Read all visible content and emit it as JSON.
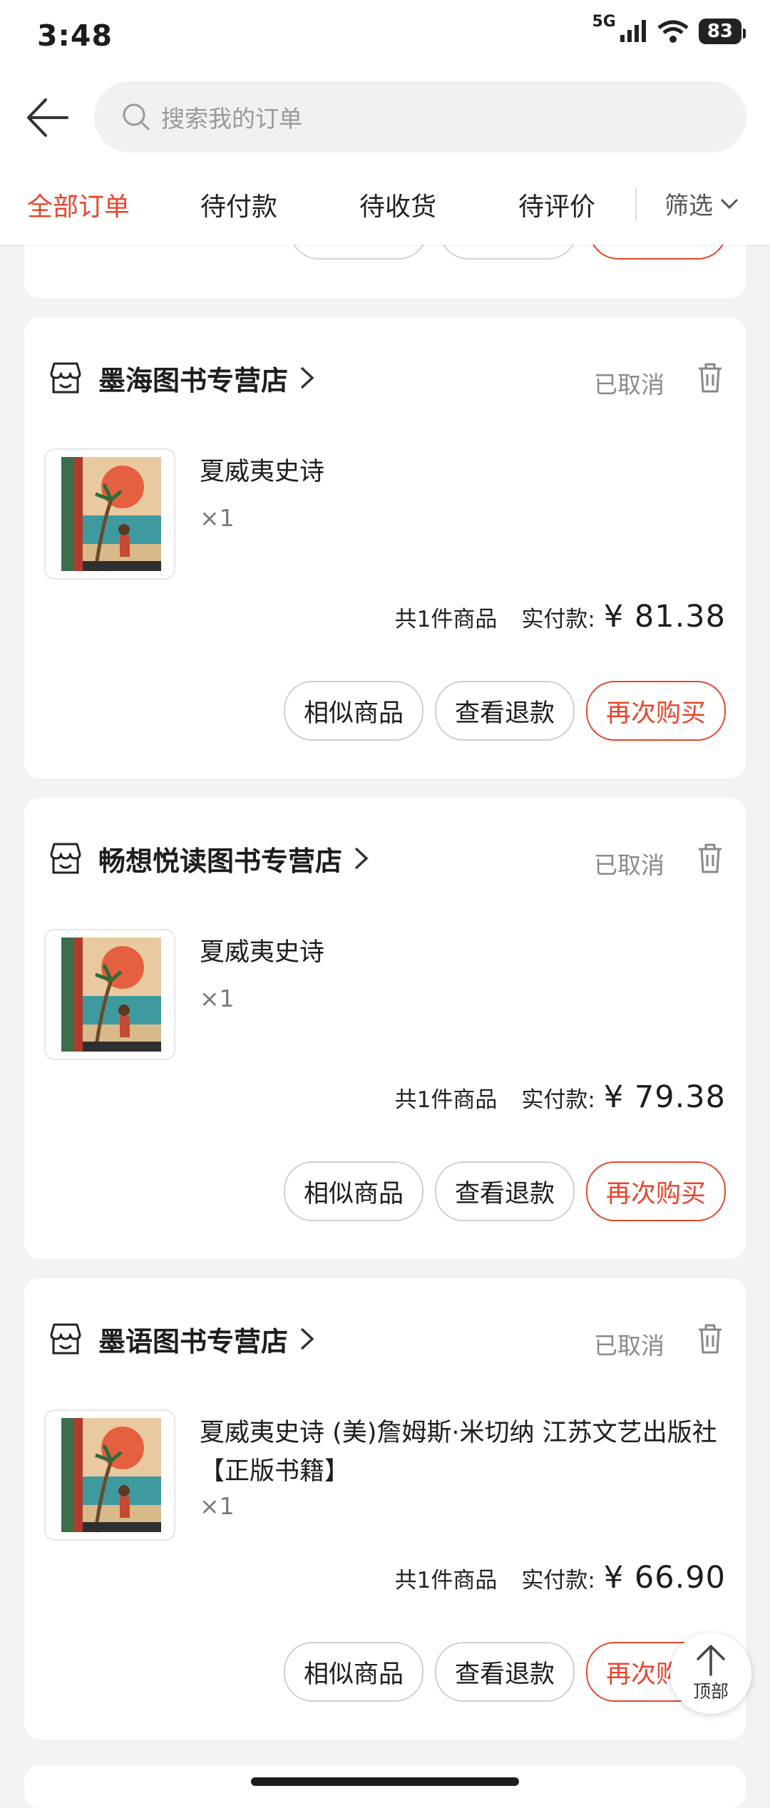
{
  "status_bar": {
    "time": "3:48",
    "network": "5G",
    "battery": "83"
  },
  "search": {
    "placeholder": "搜索我的订单"
  },
  "tabs": [
    {
      "label": "全部订单",
      "active": true
    },
    {
      "label": "待付款",
      "active": false
    },
    {
      "label": "待收货",
      "active": false
    },
    {
      "label": "待评价",
      "active": false
    }
  ],
  "filter": {
    "label": "筛选"
  },
  "orders": [
    {
      "shop": "墨海图书专营店",
      "status": "已取消",
      "product_title": "夏威夷史诗",
      "quantity": "×1",
      "item_count": "共1件商品",
      "paid_label": "实付款:",
      "price": "¥ 81.38",
      "buttons": [
        "相似商品",
        "查看退款",
        "再次购买"
      ]
    },
    {
      "shop": "畅想悦读图书专营店",
      "status": "已取消",
      "product_title": "夏威夷史诗",
      "quantity": "×1",
      "item_count": "共1件商品",
      "paid_label": "实付款:",
      "price": "¥ 79.38",
      "buttons": [
        "相似商品",
        "查看退款",
        "再次购买"
      ]
    },
    {
      "shop": "墨语图书专营店",
      "status": "已取消",
      "product_title": "夏威夷史诗 (美)詹姆斯·米切纳 江苏文艺出版社【正版书籍】",
      "quantity": "×1",
      "item_count": "共1件商品",
      "paid_label": "实付款:",
      "price": "¥ 66.90",
      "buttons": [
        "相似商品",
        "查看退款",
        "再次购买"
      ]
    }
  ],
  "back_to_top": {
    "label": "顶部"
  },
  "colors": {
    "accent": "#e8452c",
    "background": "#f3f3f3",
    "muted": "#8a8a8a"
  }
}
